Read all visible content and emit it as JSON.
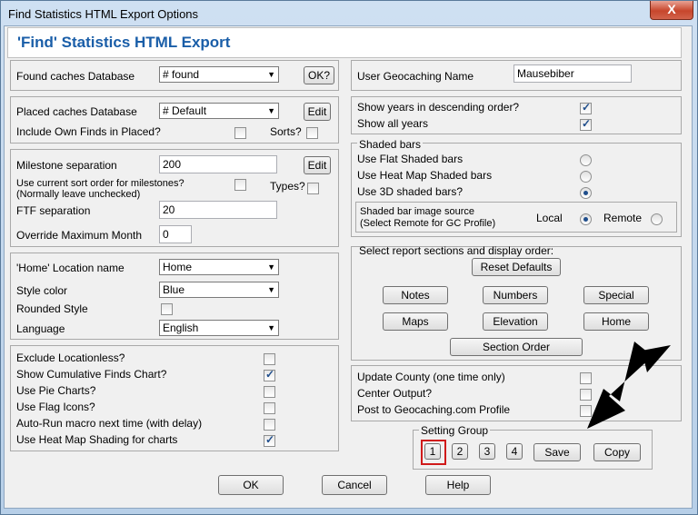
{
  "window": {
    "title": "Find Statistics HTML Export Options",
    "close": "X"
  },
  "header": "'Find' Statistics HTML Export",
  "found": {
    "label": "Found caches Database",
    "value": "# found",
    "ok_button": "OK?"
  },
  "user": {
    "label": "User Geocaching Name",
    "value": "Mausebiber"
  },
  "placed": {
    "label": "Placed caches Database",
    "value": "# Default",
    "edit_button": "Edit",
    "include_label": "Include Own Finds in Placed?",
    "sorts_label": "Sorts?"
  },
  "display": {
    "desc_years": "Show years in descending order?",
    "all_years": "Show all years"
  },
  "milestone": {
    "label": "Milestone separation",
    "value": "200",
    "edit_button": "Edit",
    "sort_label": "Use current sort order for milestones?",
    "sort_note": "(Normally leave unchecked)",
    "types_label": "Types?",
    "ftf_label": "FTF separation",
    "ftf_value": "20",
    "override_label": "Override Maximum Month",
    "override_value": "0"
  },
  "shaded": {
    "title": "Shaded bars",
    "flat": "Use Flat Shaded bars",
    "heat": "Use Heat Map Shaded bars",
    "three_d": "Use 3D shaded bars?",
    "source_label": "Shaded bar image source",
    "source_note": "(Select Remote for GC Profile)",
    "local": "Local",
    "remote": "Remote"
  },
  "home": {
    "label": "'Home' Location name",
    "value": "Home",
    "style_label": "Style color",
    "style_value": "Blue",
    "rounded_label": "Rounded Style",
    "language_label": "Language",
    "language_value": "English"
  },
  "sections": {
    "title": "Select report sections and display order:",
    "reset": "Reset Defaults",
    "notes": "Notes",
    "numbers": "Numbers",
    "special": "Special",
    "maps": "Maps",
    "elevation": "Elevation",
    "home": "Home",
    "section_order": "Section Order"
  },
  "options": {
    "locationless": "Exclude Locationless?",
    "cumulative": "Show Cumulative Finds Chart?",
    "pie": "Use Pie Charts?",
    "flags": "Use Flag Icons?",
    "autorun": "Auto-Run macro next time (with delay)",
    "heatmap": "Use Heat Map Shading for charts"
  },
  "update": {
    "county": "Update County (one time only)",
    "center": "Center Output?",
    "post": "Post to Geocaching.com Profile"
  },
  "setting_group": {
    "title": "Setting Group",
    "g1": "1",
    "g2": "2",
    "g3": "3",
    "g4": "4",
    "save": "Save",
    "copy": "Copy"
  },
  "footer": {
    "ok": "OK",
    "cancel": "Cancel",
    "help": "Help"
  },
  "checkmark": "✓",
  "arrow_glyph": "▼",
  "colors": {
    "title_blue": "#1a5ea8",
    "selected_group": "#d01a1a"
  }
}
